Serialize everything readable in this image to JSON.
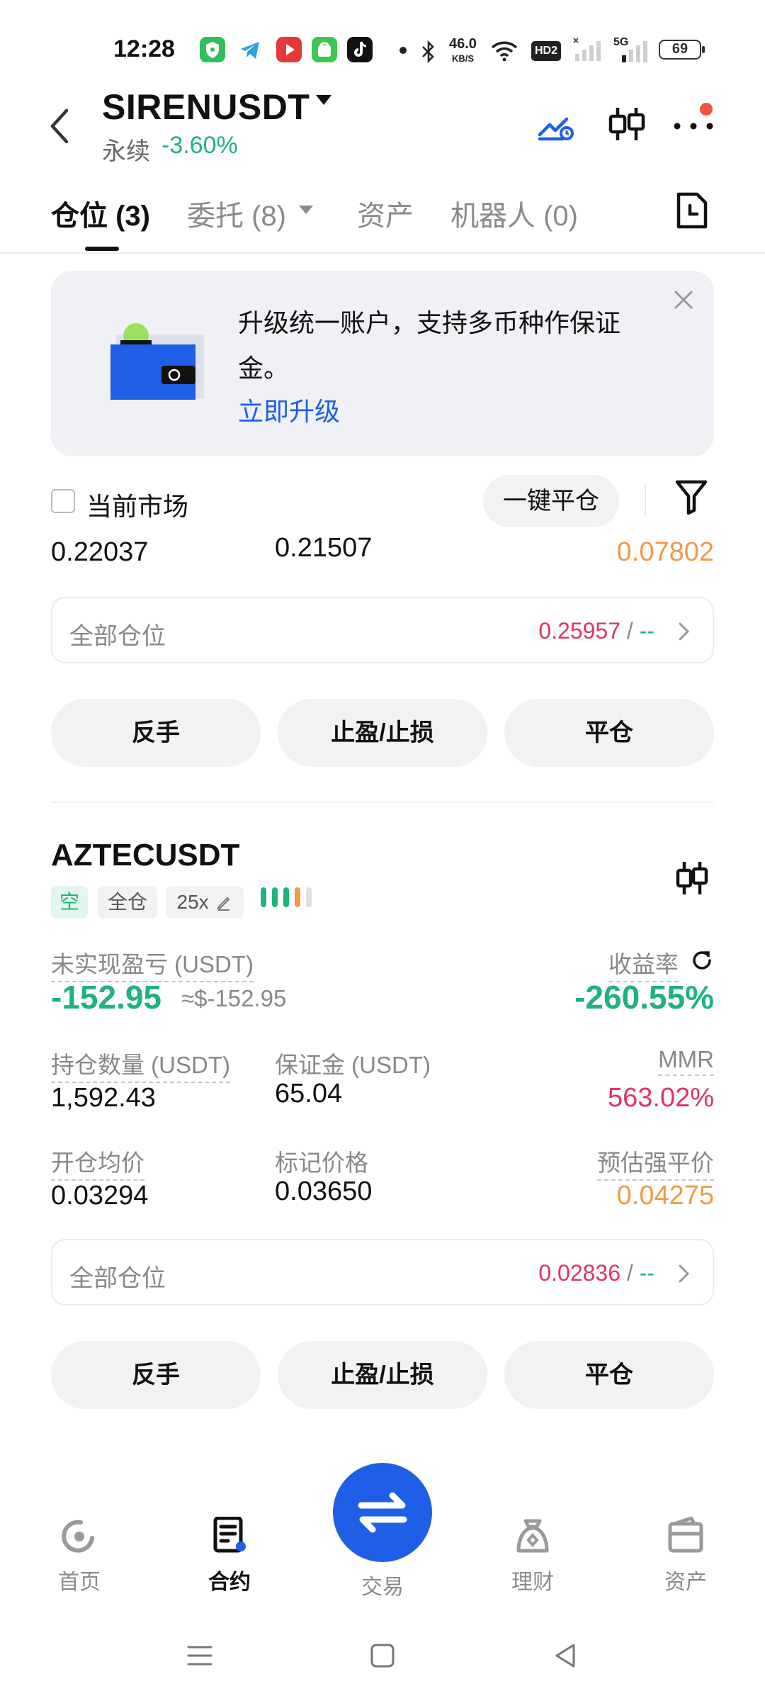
{
  "status_bar": {
    "time": "12:28",
    "net_speed_value": "46.0",
    "net_speed_unit": "KB/S",
    "hd_label": "HD2",
    "signal_label": "5G",
    "battery": "69"
  },
  "header": {
    "symbol": "SIRENUSDT",
    "contract_type": "永续",
    "change": "-3.60%"
  },
  "tabs": [
    {
      "label": "仓位 (3)",
      "active": true
    },
    {
      "label": "委托 (8)",
      "active": false
    },
    {
      "label": "资产",
      "active": false
    },
    {
      "label": "机器人 (0)",
      "active": false
    }
  ],
  "banner": {
    "text": "升级统一账户，支持多币种作保证金。",
    "link": "立即升级"
  },
  "filter": {
    "current_market_label": "当前市场",
    "close_all_label": "一键平仓"
  },
  "card1": {
    "partial_values": [
      "0.22037",
      "0.21507",
      "0.07802"
    ],
    "all_positions": {
      "label": "全部仓位",
      "value": "0.25957",
      "slash": "/",
      "dash": "--"
    },
    "actions": [
      "反手",
      "止盈/止损",
      "平仓"
    ]
  },
  "card2": {
    "symbol": "AZTECUSDT",
    "tags": [
      "空",
      "全仓",
      "25x"
    ],
    "pnl_label": "未实现盈亏 (USDT)",
    "pnl_value": "-152.95",
    "pnl_usd": "≈$-152.95",
    "roe_label": "收益率",
    "roe_value": "-260.55%",
    "size_label": "持仓数量 (USDT)",
    "size_value": "1,592.43",
    "margin_label": "保证金 (USDT)",
    "margin_value": "65.04",
    "mmr_label": "MMR",
    "mmr_value": "563.02%",
    "entry_label": "开仓均价",
    "entry_value": "0.03294",
    "mark_label": "标记价格",
    "mark_value": "0.03650",
    "liq_label": "预估强平价",
    "liq_value": "0.04275",
    "all_positions": {
      "label": "全部仓位",
      "value": "0.02836",
      "slash": "/",
      "dash": "--"
    },
    "actions": [
      "反手",
      "止盈/止损",
      "平仓"
    ]
  },
  "bottom_nav": {
    "home": "首页",
    "contract": "合约",
    "trade": "交易",
    "earn": "理财",
    "assets": "资产"
  },
  "colors": {
    "accent_blue": "#1f5ee6",
    "up_green": "#1fb37a",
    "down_red": "#e3345e",
    "warn_orange": "#f49a46"
  }
}
